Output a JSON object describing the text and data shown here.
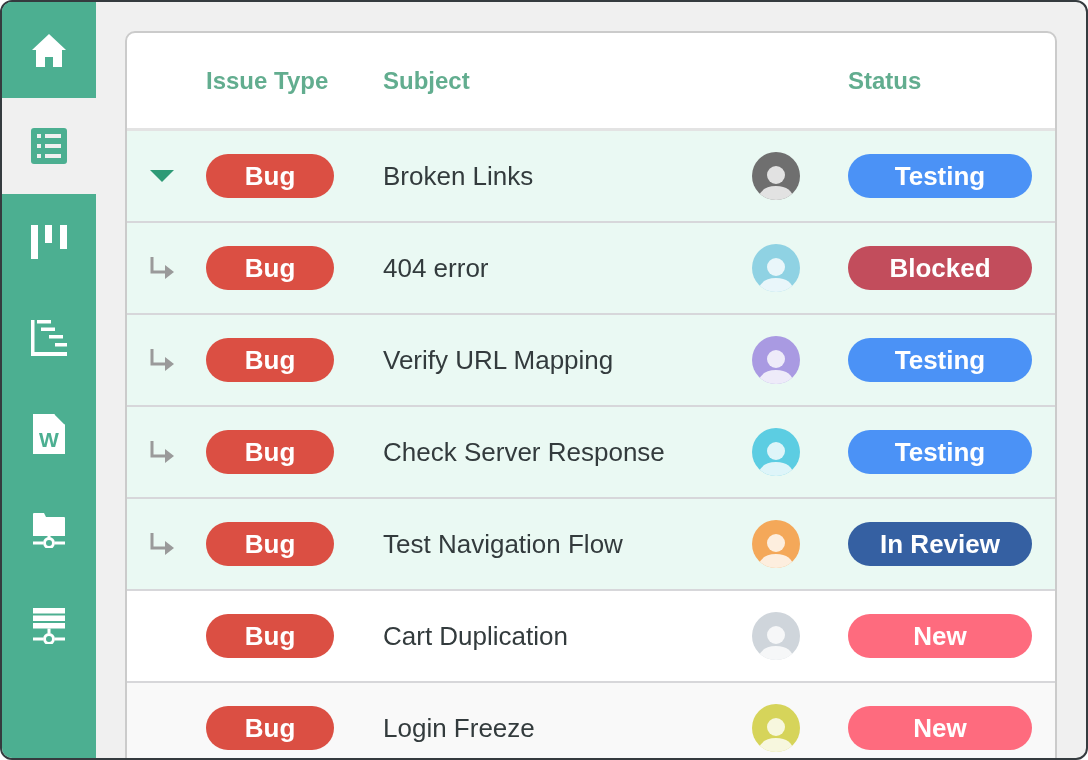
{
  "sidebar": {
    "items": [
      {
        "kind": "home",
        "selected": false
      },
      {
        "kind": "list",
        "selected": true
      },
      {
        "kind": "board",
        "selected": false
      },
      {
        "kind": "gantt",
        "selected": false
      },
      {
        "kind": "document",
        "selected": false,
        "glyph": "W"
      },
      {
        "kind": "folder_network",
        "selected": false
      },
      {
        "kind": "server_network",
        "selected": false
      }
    ]
  },
  "table": {
    "columns": [
      {
        "label": "Issue Type"
      },
      {
        "label": "Subject"
      },
      {
        "label": "Status"
      }
    ],
    "rows": [
      {
        "kind": "parent",
        "expanded": true,
        "issue_type": "Bug",
        "subject": "Broken Links",
        "avatar": {
          "color": "#6f6f6f"
        },
        "status": {
          "label": "Testing",
          "color": "#4b92f6"
        }
      },
      {
        "kind": "child",
        "issue_type": "Bug",
        "subject": "404 error",
        "avatar": {
          "color": "#8fd2e3"
        },
        "status": {
          "label": "Blocked",
          "color": "#c24d5c"
        }
      },
      {
        "kind": "child",
        "issue_type": "Bug",
        "subject": "Verify URL Mapping",
        "avatar": {
          "color": "#a99ae2"
        },
        "status": {
          "label": "Testing",
          "color": "#4b92f6"
        }
      },
      {
        "kind": "child",
        "issue_type": "Bug",
        "subject": "Check Server Response",
        "avatar": {
          "color": "#5ccde2"
        },
        "status": {
          "label": "Testing",
          "color": "#4b92f6"
        }
      },
      {
        "kind": "child",
        "issue_type": "Bug",
        "subject": "Test Navigation Flow",
        "avatar": {
          "color": "#f4a859"
        },
        "status": {
          "label": "In Review",
          "color": "#3560a2"
        }
      },
      {
        "kind": "plain",
        "issue_type": "Bug",
        "subject": "Cart Duplication",
        "avatar": {
          "color": "#cfd5db"
        },
        "status": {
          "label": "New",
          "color": "#fe6b7e"
        }
      },
      {
        "kind": "plain",
        "issue_type": "Bug",
        "subject": "Login Freeze",
        "avatar": {
          "color": "#d6d45a"
        },
        "status": {
          "label": "New",
          "color": "#fe6b7e"
        }
      }
    ]
  }
}
